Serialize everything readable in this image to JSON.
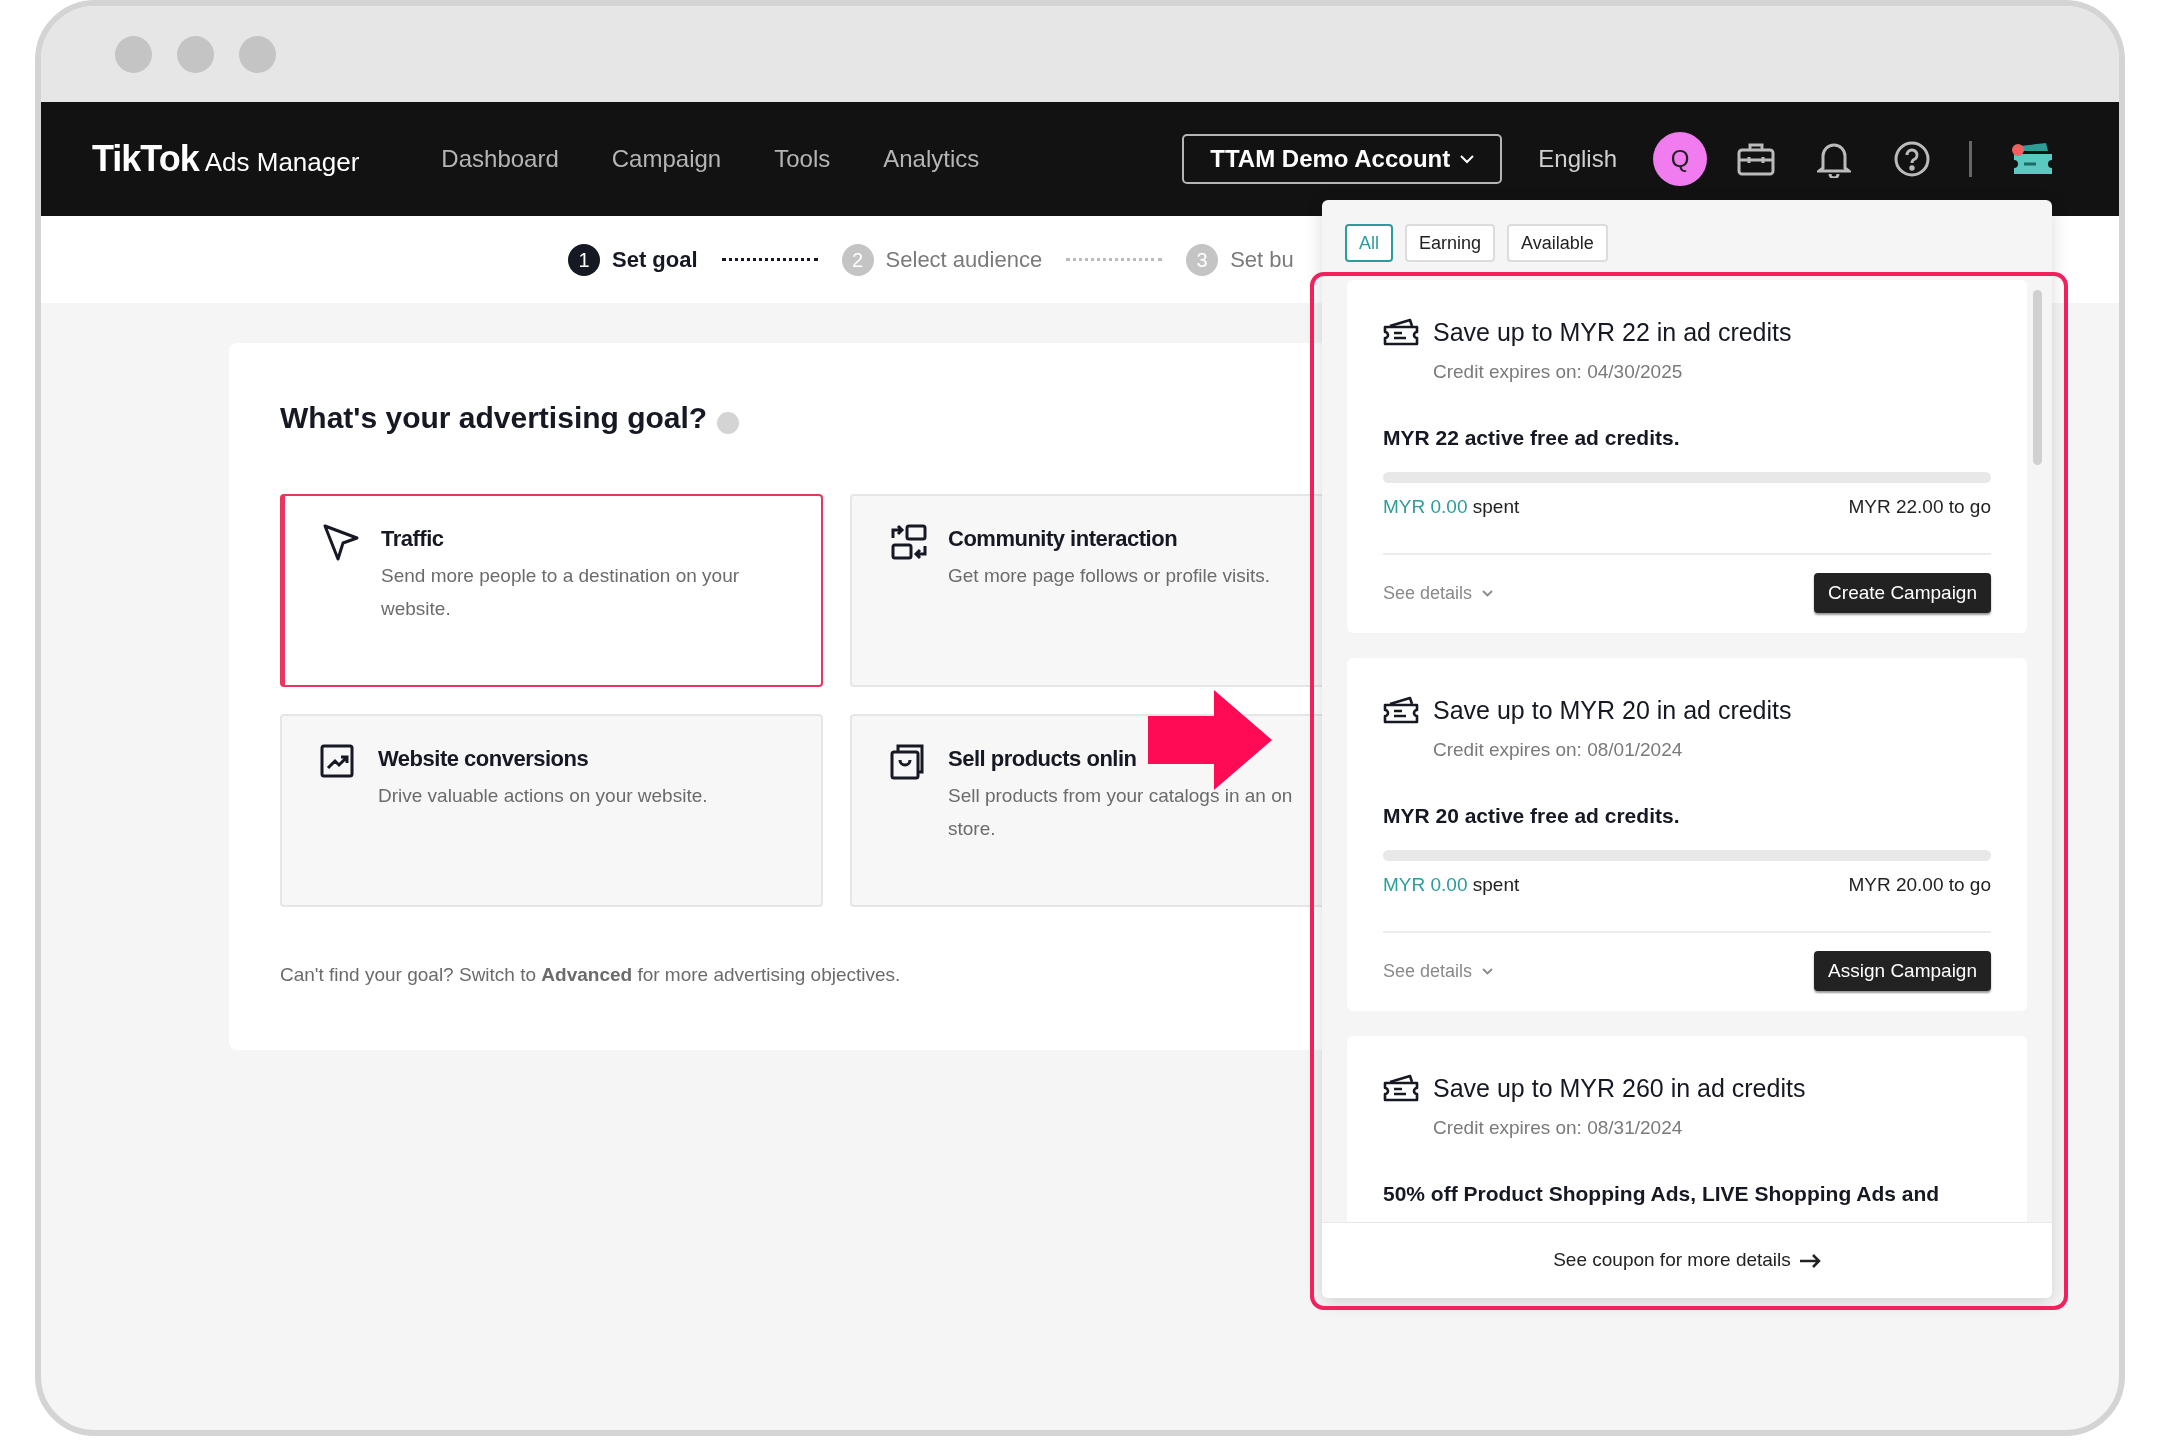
{
  "header": {
    "logo": "TikTok",
    "logo_suffix": "Ads Manager",
    "nav": [
      {
        "label": "Dashboard"
      },
      {
        "label": "Campaign"
      },
      {
        "label": "Tools"
      },
      {
        "label": "Analytics"
      }
    ],
    "account": "TTAM Demo Account",
    "language": "English",
    "avatar": "Q"
  },
  "steps": [
    {
      "number": "1",
      "label": "Set goal",
      "active": true
    },
    {
      "number": "2",
      "label": "Select audience",
      "active": false
    },
    {
      "number": "3",
      "label": "Set bu",
      "active": false
    }
  ],
  "goal": {
    "title": "What's your advertising goal?",
    "options": [
      {
        "kind": "cursor",
        "title": "Traffic",
        "lines": [
          "Send more people to a destination on your",
          "website."
        ],
        "selected": true
      },
      {
        "kind": "swap",
        "title": "Community interaction",
        "lines": [
          "Get more page follows or profile visits."
        ],
        "selected": false
      },
      {
        "kind": "chart",
        "title": "Website conversions",
        "lines": [
          "Drive valuable actions on your website."
        ],
        "selected": false
      },
      {
        "kind": "bag",
        "title": "Sell products onlin",
        "lines": [
          "Sell products from your catalogs in an on",
          "store."
        ],
        "selected": false
      }
    ],
    "footer": "Can't find your goal? Switch to **Advanced** for more advertising objectives."
  },
  "coupons": {
    "filters": [
      {
        "label": "All",
        "selected": true
      },
      {
        "label": "Earning",
        "selected": false
      },
      {
        "label": "Available",
        "selected": false
      }
    ],
    "items": [
      {
        "title": "Save up to MYR 22 in ad credits",
        "expires": "Credit expires on: 04/30/2025",
        "summary": "MYR 22 active free ad credits.",
        "level": 0,
        "spent_amount": "MYR 0.00",
        "spent_label": "spent",
        "remaining": "MYR 22.00 to go",
        "details": "See details",
        "action": "Create Campaign"
      },
      {
        "title": "Save up to MYR 20 in ad credits",
        "expires": "Credit expires on: 08/01/2024",
        "summary": "MYR 20 active free ad credits.",
        "level": 0,
        "spent_amount": "MYR 0.00",
        "spent_label": "spent",
        "remaining": "MYR 20.00 to go",
        "details": "See details",
        "action": "Assign Campaign"
      },
      {
        "title": "Save up to MYR 260 in ad credits",
        "expires": "Credit expires on: 08/31/2024",
        "summary": "50% off Product Shopping Ads, LIVE Shopping Ads and"
      }
    ],
    "footer_link": "See coupon for more details"
  }
}
